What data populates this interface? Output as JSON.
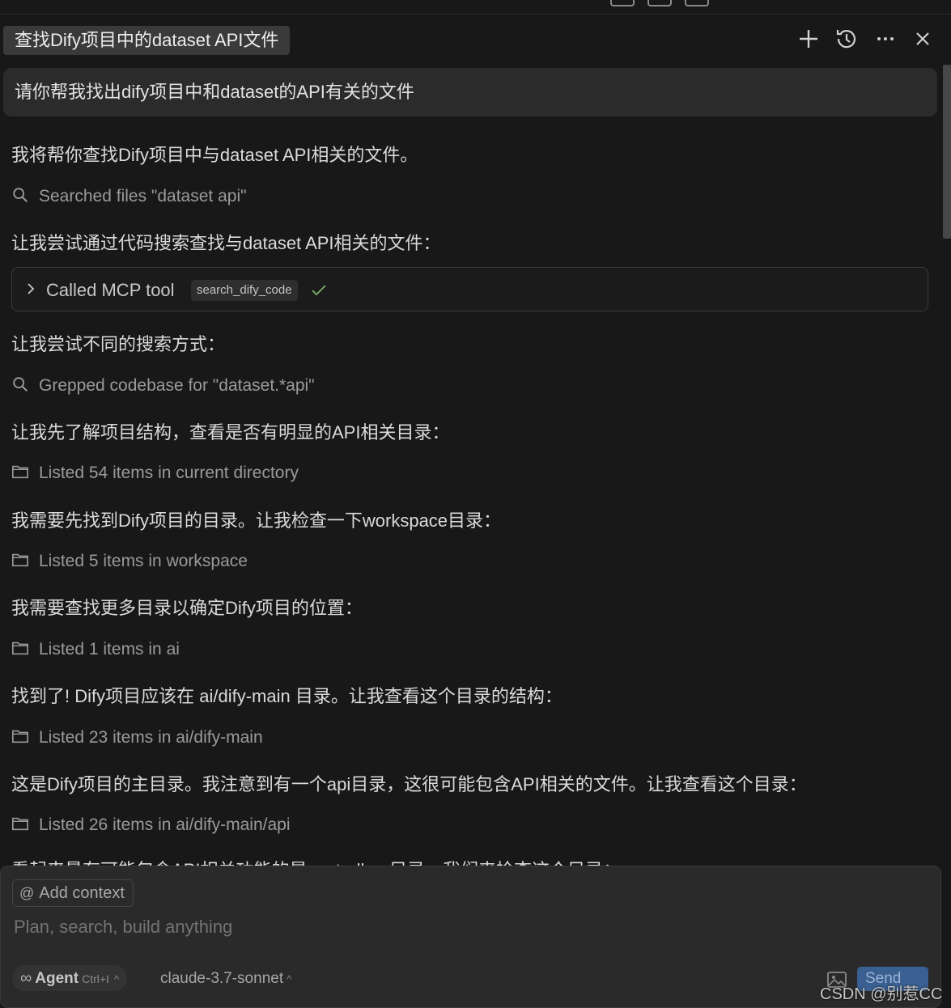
{
  "header": {
    "chat_title": "查找Dify项目中的dataset API文件",
    "actions": [
      "plus-icon",
      "history-icon",
      "more-icon",
      "close-icon"
    ]
  },
  "conversation": {
    "user_message": "请你帮我找出dify项目中和dataset的API有关的文件",
    "lines": [
      "我将帮你查找Dify项目中与dataset API相关的文件。",
      "让我尝试通过代码搜索查找与dataset API相关的文件：",
      "让我尝试不同的搜索方式：",
      "让我先了解项目结构，查看是否有明显的API相关目录：",
      "我需要先找到Dify项目的目录。让我检查一下workspace目录：",
      "我需要查找更多目录以确定Dify项目的位置：",
      "找到了! Dify项目应该在 ai/dify-main 目录。让我查看这个目录的结构：",
      "这是Dify项目的主目录。我注意到有一个api目录，这很可能包含API相关的文件。让我查看这个目录：",
      "看起来最有可能包含API相关功能的是controllers目录。我们来检查这个目录："
    ],
    "actions": [
      "Searched files \"dataset api\"",
      "Grepped codebase for \"dataset.*api\"",
      "Listed 54 items in current directory",
      "Listed 5 items in workspace",
      "Listed 1 items in ai",
      "Listed 23 items in ai/dify-main",
      "Listed 26 items in ai/dify-main/api"
    ],
    "mcp_call": {
      "label": "Called MCP tool",
      "tool_name": "search_dify_code",
      "status": "success"
    }
  },
  "composer": {
    "add_context": "Add context",
    "placeholder": "Plan, search, build anything",
    "mode": "Agent",
    "mode_shortcut": "Ctrl+I",
    "model": "claude-3.7-sonnet",
    "send": "Send"
  },
  "watermark": "CSDN @别惹CC",
  "colors": {
    "background": "#181818",
    "bubble": "#2b2b2b",
    "composer": "#2a2a2a",
    "send_button": "#3a5f91",
    "success_check": "#7bb26a"
  }
}
